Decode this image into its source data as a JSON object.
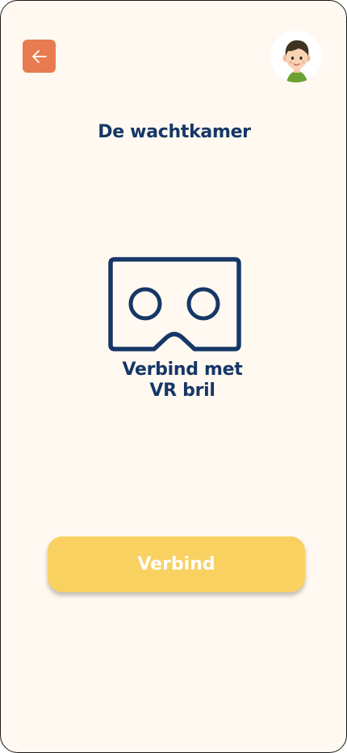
{
  "page": {
    "title": "De wachtkamer"
  },
  "header": {
    "back_icon": "arrow-left-icon",
    "avatar_icon": "boy-avatar-icon"
  },
  "vr": {
    "icon": "vr-headset-icon",
    "label_line1": "Verbind met",
    "label_line2": "VR bril"
  },
  "actions": {
    "connect_label": "Verbind"
  },
  "colors": {
    "background": "#fff9f1",
    "accent_orange": "#e87b4f",
    "navy": "#163766",
    "button_yellow": "#f8d161",
    "button_text": "#ffffff"
  }
}
